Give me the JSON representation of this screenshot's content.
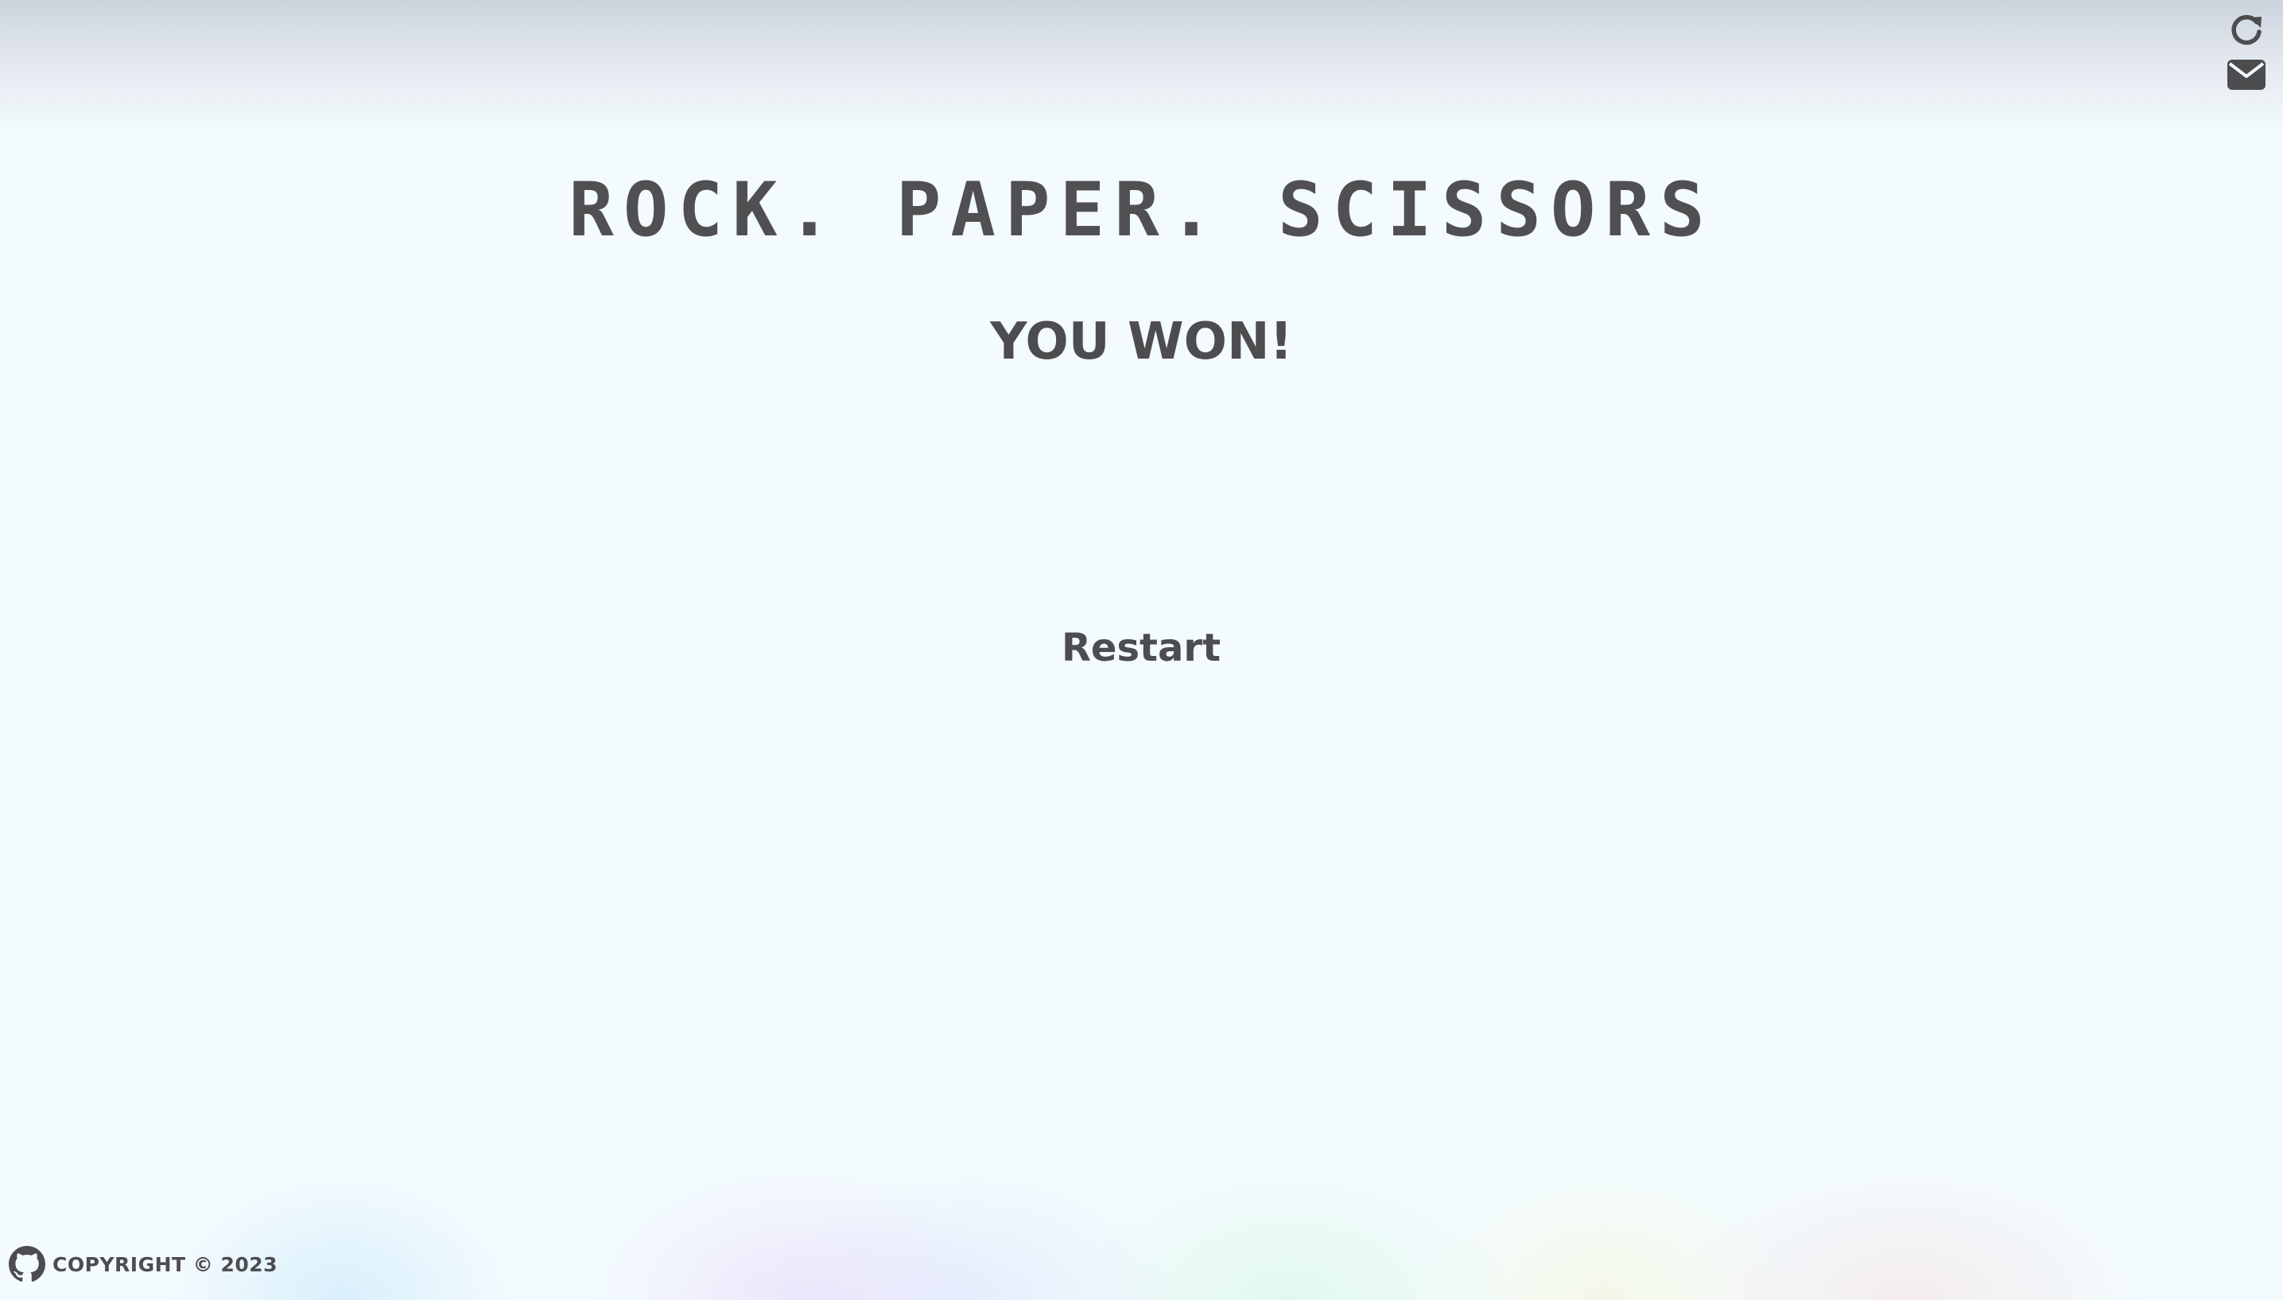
{
  "header": {
    "icons": [
      "refresh-icon",
      "mail-icon"
    ]
  },
  "game": {
    "title": "ROCK. PAPER. SCISSORS",
    "result": "YOU WON!",
    "restart_label": "Restart"
  },
  "footer": {
    "icon": "github-icon",
    "copyright": "COPYRIGHT © 2023"
  },
  "colors": {
    "background": "#f3fbfe",
    "text": "#4d4d4f"
  }
}
